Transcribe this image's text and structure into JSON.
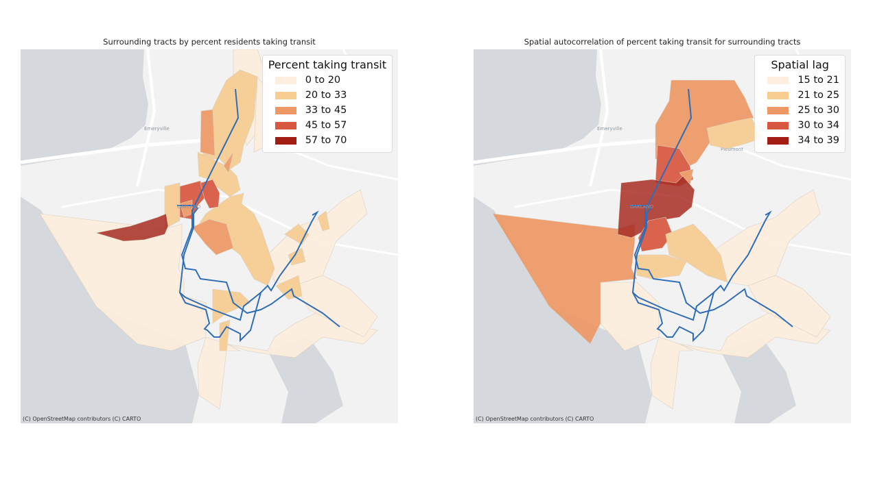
{
  "panels": [
    {
      "title": "Surrounding tracts by percent residents taking transit",
      "legend": {
        "title": "Percent taking transit",
        "items": [
          {
            "label": "0 to 20",
            "color": "#fdeedd"
          },
          {
            "label": "20 to 33",
            "color": "#f6cc91"
          },
          {
            "label": "33 to 45",
            "color": "#ee9866"
          },
          {
            "label": "45 to 57",
            "color": "#d7573f"
          },
          {
            "label": "57 to 70",
            "color": "#a11d13"
          }
        ]
      },
      "attribution": "(C) OpenStreetMap contributors (C) CARTO",
      "place_labels": [
        "Emeryville",
        "OAKLAND"
      ]
    },
    {
      "title": "Spatial autocorrelation of percent taking transit for surrounding tracts",
      "legend": {
        "title": "Spatial lag",
        "items": [
          {
            "label": "15 to 21",
            "color": "#fdeedd"
          },
          {
            "label": "21 to 25",
            "color": "#f6cc91"
          },
          {
            "label": "25 to 30",
            "color": "#ee9866"
          },
          {
            "label": "30 to 34",
            "color": "#d7573f"
          },
          {
            "label": "34 to 39",
            "color": "#a11d13"
          }
        ]
      },
      "attribution": "(C) OpenStreetMap contributors (C) CARTO",
      "place_labels": [
        "Emeryville",
        "Piedmont",
        "OAKLAND"
      ]
    }
  ],
  "basemap_colors": {
    "water": "#d5d9dd",
    "land": "#f2f2f2",
    "road": "#ffffff",
    "route": "#2f6db5"
  },
  "chart_data": [
    {
      "type": "choropleth",
      "title": "Surrounding tracts by percent residents taking transit",
      "legend_title": "Percent taking transit",
      "classes": [
        "0 to 20",
        "20 to 33",
        "33 to 45",
        "45 to 57",
        "57 to 70"
      ],
      "legend_placement": "top-right",
      "overlay": "transit route lines (blue)"
    },
    {
      "type": "choropleth",
      "title": "Spatial autocorrelation of percent taking transit for surrounding tracts",
      "legend_title": "Spatial lag",
      "classes": [
        "15 to 21",
        "21 to 25",
        "25 to 30",
        "30 to 34",
        "34 to 39"
      ],
      "legend_placement": "top-right",
      "overlay": "transit route lines (blue)"
    }
  ]
}
